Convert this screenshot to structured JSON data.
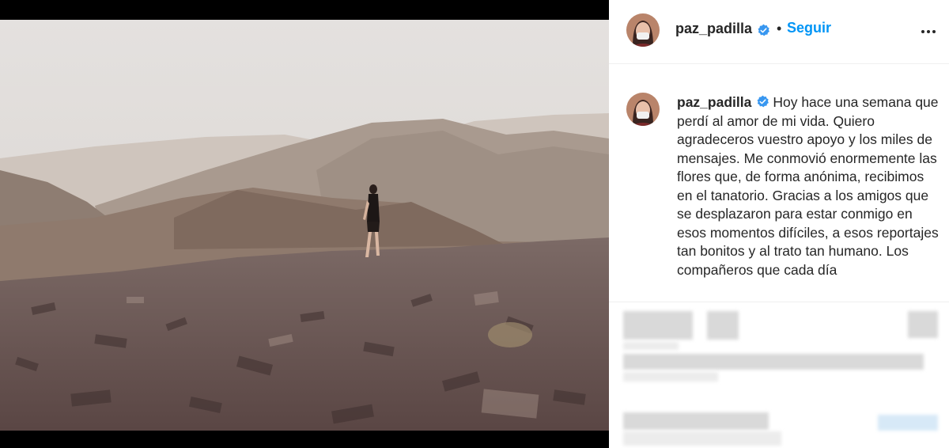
{
  "post": {
    "username": "paz_padilla",
    "follow_label": "Seguir",
    "separator": "•",
    "more_icon": "more-horizontal-icon",
    "verified_icon": "verified-badge-icon"
  },
  "caption": {
    "username": "paz_padilla",
    "text": "Hoy hace una semana que perdí al amor de mi vida. Quiero agradeceros vuestro apoyo y los miles de mensajes. Me conmovió enormemente las flores que, de forma anónima, recibimos en el tanatorio. Gracias a los amigos que se desplazaron para estar conmigo en esos momentos difíciles, a esos reportajes tan bonitos y al trato tan humano. Los compañeros que cada día"
  },
  "colors": {
    "accent": "#0095f6",
    "verified": "#3897f0",
    "text": "#262626"
  }
}
